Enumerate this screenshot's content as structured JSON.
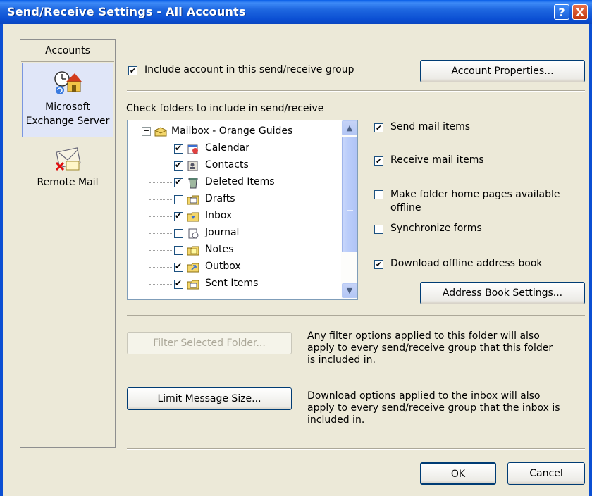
{
  "window": {
    "title": "Send/Receive Settings - All Accounts",
    "help_label": "?",
    "close_label": "X"
  },
  "accounts": {
    "header": "Accounts",
    "items": [
      {
        "label": "Microsoft Exchange Server",
        "icon": "exchange-server-icon"
      },
      {
        "label": "Remote Mail",
        "icon": "remote-mail-icon"
      }
    ]
  },
  "include_account": {
    "label": "Include account in this send/receive group",
    "checked": true
  },
  "account_properties_button": "Account Properties...",
  "folders_heading": "Check folders to include in send/receive",
  "mailbox": {
    "label": "Mailbox - Orange Guides",
    "expander": "−"
  },
  "folders": [
    {
      "label": "Calendar",
      "checked": true,
      "icon": "calendar-icon"
    },
    {
      "label": "Contacts",
      "checked": true,
      "icon": "contacts-icon"
    },
    {
      "label": "Deleted Items",
      "checked": true,
      "icon": "deleted-items-icon"
    },
    {
      "label": "Drafts",
      "checked": false,
      "icon": "drafts-icon"
    },
    {
      "label": "Inbox",
      "checked": true,
      "icon": "inbox-icon"
    },
    {
      "label": "Journal",
      "checked": false,
      "icon": "journal-icon"
    },
    {
      "label": "Notes",
      "checked": false,
      "icon": "notes-icon"
    },
    {
      "label": "Outbox",
      "checked": true,
      "icon": "outbox-icon"
    },
    {
      "label": "Sent Items",
      "checked": true,
      "icon": "sent-items-icon"
    }
  ],
  "options": {
    "send_mail": {
      "label": "Send mail items",
      "checked": true
    },
    "receive_mail": {
      "label": "Receive mail items",
      "checked": true
    },
    "home_pages": {
      "line1": "Make folder home pages available",
      "line2": "offline",
      "checked": false
    },
    "sync_forms": {
      "label": "Synchronize forms",
      "checked": false
    },
    "offline_ab": {
      "label": "Download offline address book",
      "checked": true
    }
  },
  "address_book_button": "Address Book Settings...",
  "filter_button": "Filter Selected Folder...",
  "filter_desc": {
    "line1": "Any filter options applied to this folder will also",
    "line2": "apply to every send/receive group that this folder",
    "line3": "is included in."
  },
  "limit_button": "Limit Message Size...",
  "limit_desc": {
    "line1": "Download options applied to the inbox will also",
    "line2": "apply to every send/receive group that the inbox is",
    "line3": "included in."
  },
  "ok_button": "OK",
  "cancel_button": "Cancel",
  "colors": {
    "titlebar": "#0b4fd3",
    "dialog_bg": "#ece9d8",
    "selection": "#e0e6f8"
  }
}
